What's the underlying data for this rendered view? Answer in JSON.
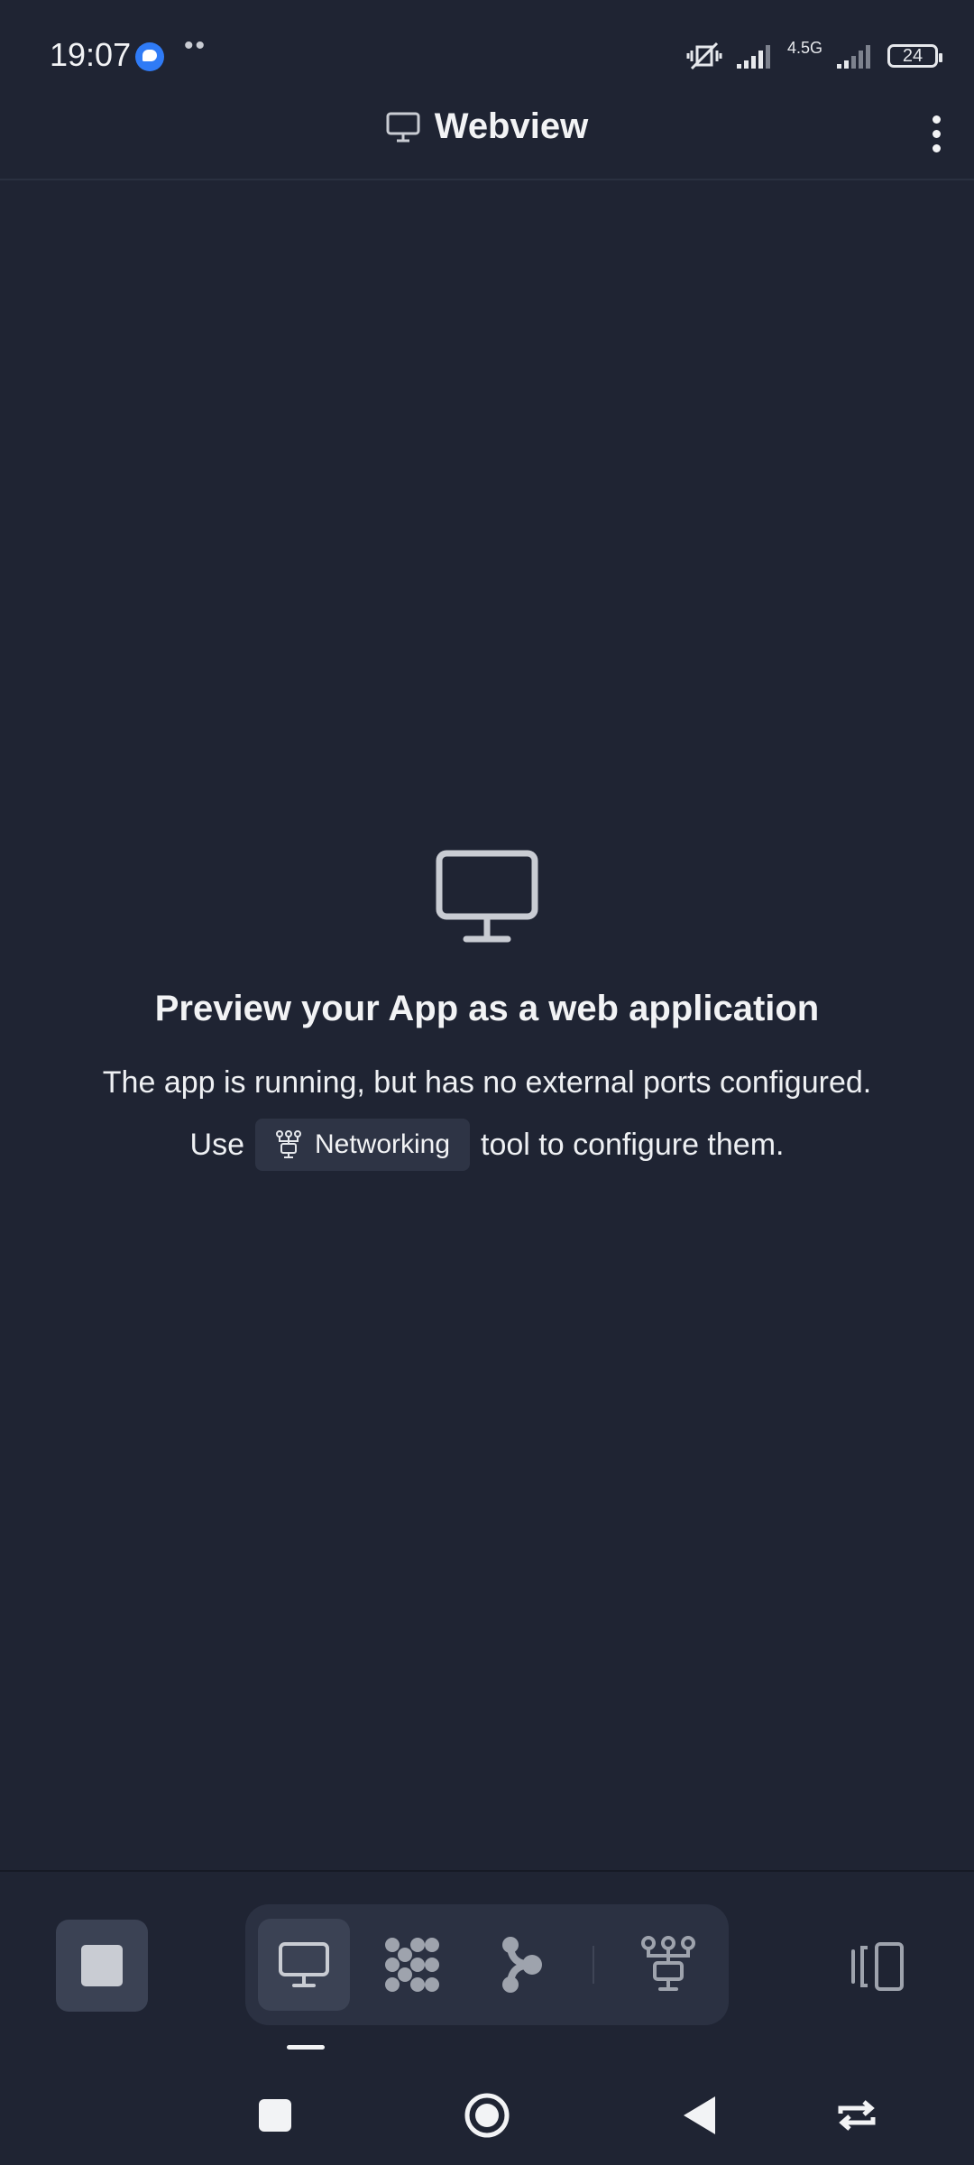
{
  "status_bar": {
    "time": "19:07",
    "network": "4.5G",
    "battery": "24"
  },
  "header": {
    "title": "Webview",
    "icon": "monitor-icon",
    "menu_icon": "kebab-menu-icon"
  },
  "empty_state": {
    "icon": "monitor-icon",
    "title": "Preview your App as a web application",
    "line1": "The app is running, but has no external ports configured.",
    "line2_prefix": "Use",
    "chip_label": "Networking",
    "chip_icon": "network-icon",
    "line2_suffix": "tool to configure them."
  },
  "bottom_toolbar": {
    "stop_icon": "stop-icon",
    "tools": [
      {
        "icon": "monitor-icon",
        "active": true
      },
      {
        "icon": "dots-grid-icon",
        "active": false
      },
      {
        "icon": "branch-icon",
        "active": false
      },
      {
        "icon": "network-icon",
        "active": false
      }
    ],
    "panel_icon": "side-panel-icon"
  },
  "system_nav": {
    "buttons": [
      "recents-icon",
      "home-icon",
      "back-icon",
      "rotate-icon"
    ]
  },
  "colors": {
    "background": "#1f2433",
    "toolbar_group": "#2b3142",
    "active_tool": "#3b4254",
    "text": "#f2f3f5"
  }
}
